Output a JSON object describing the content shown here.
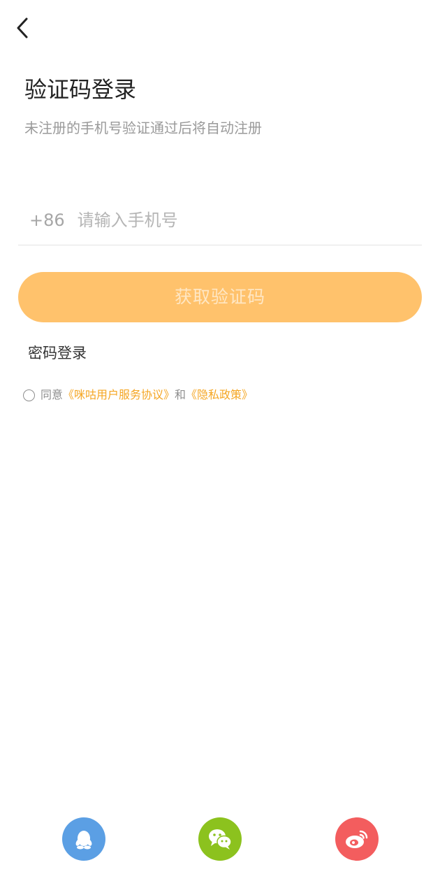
{
  "header": {
    "back_icon": "chevron-left-icon",
    "title": "验证码登录",
    "subtitle": "未注册的手机号验证通过后将自动注册"
  },
  "phone": {
    "country_code": "+86",
    "placeholder": "请输入手机号",
    "value": ""
  },
  "get_code_button": {
    "label": "获取验证码",
    "bg_color": "#ffc26c",
    "text_color": "#ffe7c4"
  },
  "password_login_label": "密码登录",
  "agreement": {
    "prefix": "同意",
    "link1": "《咪咕用户服务协议》",
    "conjunction": "和",
    "link2": "《隐私政策》",
    "checked": false,
    "link_color": "#f5a623"
  },
  "social_login": [
    {
      "name": "qq",
      "icon": "qq-penguin-icon",
      "color": "#5b9fe4"
    },
    {
      "name": "wechat",
      "icon": "wechat-icon",
      "color": "#8cc21e"
    },
    {
      "name": "weibo",
      "icon": "weibo-icon",
      "color": "#f35d5e"
    }
  ]
}
